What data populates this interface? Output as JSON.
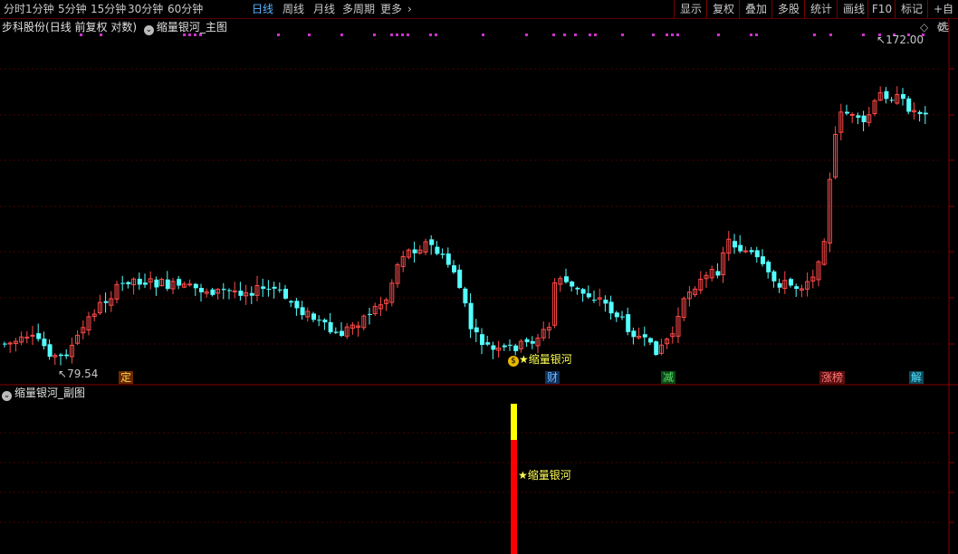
{
  "toolbar": {
    "periods": [
      "分时",
      "1分钟",
      "5分钟",
      "15分钟",
      "30分钟",
      "60分钟",
      "日线",
      "周线",
      "月线",
      "多周期",
      "更多"
    ],
    "active_period": "日线",
    "more_chevron": "›",
    "right_buttons": [
      "显示",
      "复权",
      "叠加",
      "多股",
      "统计",
      "画线",
      "F10",
      "标记",
      "+自选"
    ]
  },
  "main_panel": {
    "stock_name": "步科股份",
    "mode": "(日线 前复权 对数)",
    "indicator": "缩量银河_主图",
    "high_label": "172.00",
    "low_label": "79.54",
    "signal_label": "缩量银河",
    "signal_icon_glyph": "$",
    "badges": [
      {
        "text": "定",
        "color": "#ffd24a",
        "bg": "#6a2a00"
      },
      {
        "text": "财",
        "color": "#6fb9ff",
        "bg": "#10305a"
      },
      {
        "text": "减",
        "color": "#55dd66",
        "bg": "#0d4a17"
      },
      {
        "text": "涨榜",
        "color": "#ff7777",
        "bg": "#5a1010"
      },
      {
        "text": "解",
        "color": "#55e0ff",
        "bg": "#0d4a5a"
      }
    ]
  },
  "sub_panel": {
    "indicator": "缩量银河_副图",
    "signal_label": "★缩量银河"
  },
  "colors": {
    "up": "#ff4a4a",
    "down": "#54ffff",
    "grid": "#4a0000",
    "signal": "#ffff55",
    "dots": "#cc33cc",
    "bar_red": "#ff0000",
    "bar_yellow": "#ffff00"
  }
}
